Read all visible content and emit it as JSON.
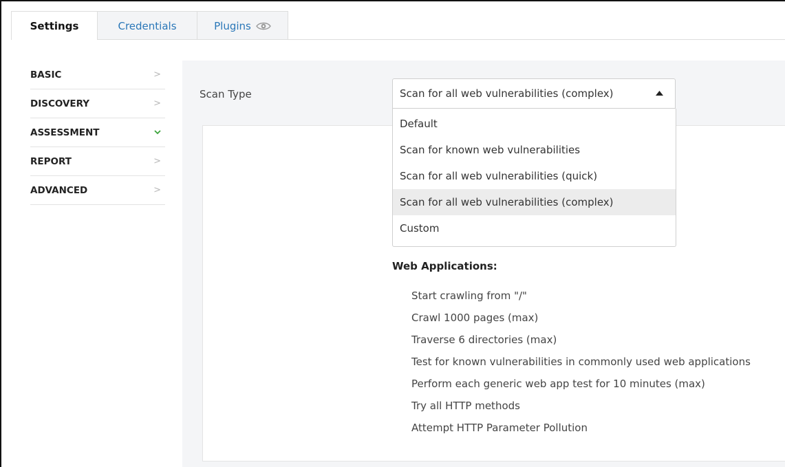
{
  "tabs": [
    {
      "label": "Settings"
    },
    {
      "label": "Credentials"
    },
    {
      "label": "Plugins"
    }
  ],
  "nav": {
    "items": [
      {
        "label": "BASIC",
        "chevron": ">"
      },
      {
        "label": "DISCOVERY",
        "chevron": ">"
      },
      {
        "label": "ASSESSMENT",
        "chevron": "⌄"
      },
      {
        "label": "REPORT",
        "chevron": ">"
      },
      {
        "label": "ADVANCED",
        "chevron": ">"
      }
    ]
  },
  "scan": {
    "label": "Scan Type",
    "selected": "Scan for all web vulnerabilities (complex)",
    "options": [
      "Default",
      "Scan for known web vulnerabilities",
      "Scan for all web vulnerabilities (quick)",
      "Scan for all web vulnerabilities (complex)",
      "Custom"
    ]
  },
  "web_apps": {
    "title": "Web Applications:",
    "items": [
      "Start crawling from \"/\"",
      "Crawl 1000 pages (max)",
      "Traverse 6 directories (max)",
      "Test for known vulnerabilities in commonly used web applications",
      "Perform each generic web app test for 10 minutes (max)",
      "Try all HTTP methods",
      "Attempt HTTP Parameter Pollution"
    ]
  },
  "colors": {
    "link": "#2a77b8",
    "accent_green": "#3aa33a",
    "panel_bg": "#f4f5f7"
  }
}
